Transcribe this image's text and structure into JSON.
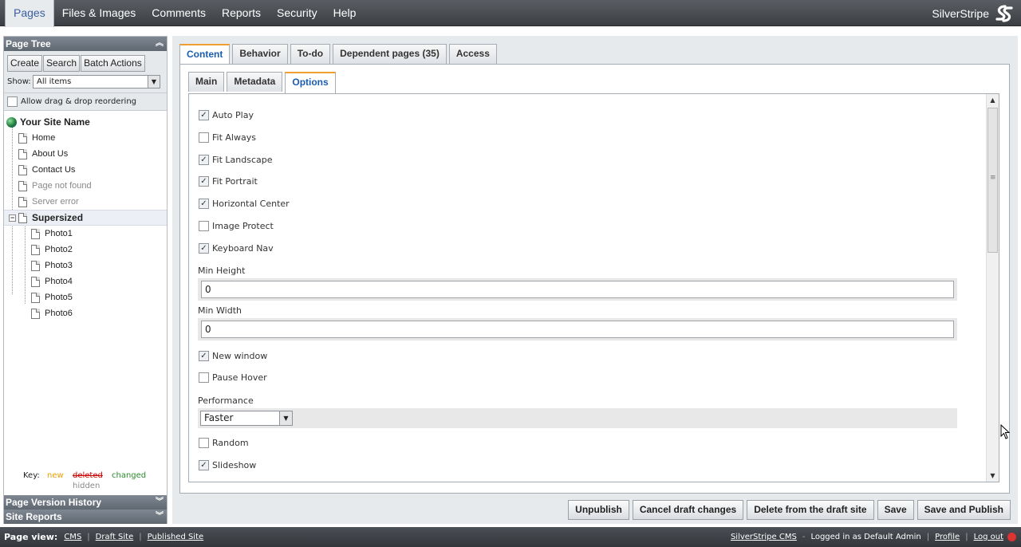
{
  "topbar": {
    "menu": [
      "Pages",
      "Files & Images",
      "Comments",
      "Reports",
      "Security",
      "Help"
    ],
    "brand": "SilverStripe"
  },
  "leftpanel": {
    "title": "Page Tree",
    "buttons": {
      "create": "Create",
      "search": "Search",
      "batch": "Batch Actions"
    },
    "show_label": "Show:",
    "show_value": "All items",
    "drag_label": "Allow drag & drop reordering",
    "tree": {
      "root": "Your Site Name",
      "items": [
        "Home",
        "About Us",
        "Contact Us",
        "Page not found",
        "Server error"
      ],
      "selected": "Supersized",
      "children": [
        "Photo1",
        "Photo2",
        "Photo3",
        "Photo4",
        "Photo5",
        "Photo6"
      ]
    },
    "key": {
      "label": "Key:",
      "new": "new",
      "deleted": "deleted",
      "changed": "changed",
      "hidden": "hidden"
    },
    "version_history": "Page Version History",
    "site_reports": "Site Reports"
  },
  "main": {
    "tabs": [
      "Content",
      "Behavior",
      "To-do",
      "Dependent pages (35)",
      "Access"
    ],
    "subtabs": [
      "Main",
      "Metadata",
      "Options"
    ],
    "fields": {
      "auto_play": {
        "label": "Auto Play",
        "checked": true
      },
      "fit_always": {
        "label": "Fit Always",
        "checked": false
      },
      "fit_landscape": {
        "label": "Fit Landscape",
        "checked": true
      },
      "fit_portrait": {
        "label": "Fit Portrait",
        "checked": true
      },
      "horizontal_center": {
        "label": "Horizontal Center",
        "checked": true
      },
      "image_protect": {
        "label": "Image Protect",
        "checked": false
      },
      "keyboard_nav": {
        "label": "Keyboard Nav",
        "checked": true
      },
      "min_height": {
        "label": "Min Height",
        "value": "0"
      },
      "min_width": {
        "label": "Min Width",
        "value": "0"
      },
      "new_window": {
        "label": "New window",
        "checked": true
      },
      "pause_hover": {
        "label": "Pause Hover",
        "checked": false
      },
      "performance": {
        "label": "Performance",
        "value": "Faster"
      },
      "random": {
        "label": "Random",
        "checked": false
      },
      "slideshow": {
        "label": "Slideshow",
        "checked": true
      }
    },
    "actions": {
      "unpublish": "Unpublish",
      "cancel": "Cancel draft changes",
      "delete": "Delete from the draft site",
      "save": "Save",
      "save_publish": "Save and Publish"
    }
  },
  "footer": {
    "page_view": "Page view:",
    "links": [
      "CMS",
      "Draft Site",
      "Published Site"
    ],
    "cms_link": "SilverStripe CMS",
    "logged_in": "Logged in as Default Admin",
    "profile": "Profile",
    "logout": "Log out"
  }
}
